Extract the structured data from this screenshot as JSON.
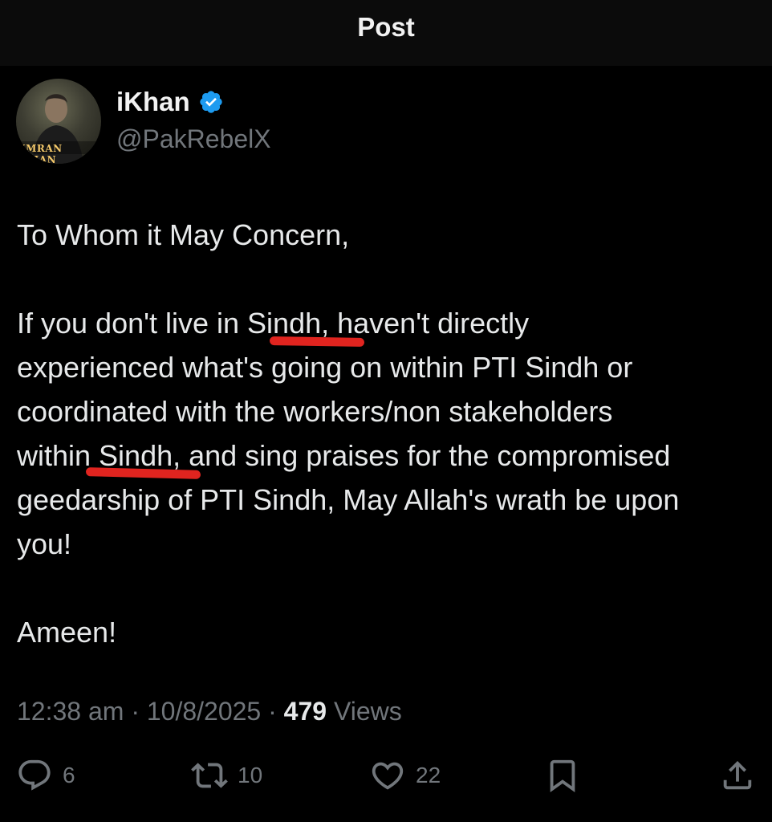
{
  "header": {
    "title": "Post"
  },
  "author": {
    "display_name": "iKhan",
    "handle": "@PakRebelX",
    "verified": true,
    "avatar_caption": "IMRAN KHAN"
  },
  "post": {
    "greeting": "To Whom it May Concern,",
    "paragraph": [
      "If you don't live in Sindh, haven't directly",
      "experienced what's going on within PTI Sindh or",
      "coordinated with the workers/non stakeholders",
      "within Sindh, and sing praises for the compromised",
      "geedarship of PTI Sindh, May Allah's wrath be upon",
      "you!"
    ],
    "closing": "Ameen!"
  },
  "meta": {
    "time": "12:38 am",
    "separator": "·",
    "date": "10/8/2025",
    "views_count": "479",
    "views_label": "Views"
  },
  "actions": {
    "replies": "6",
    "reposts": "10",
    "likes": "22"
  },
  "colors": {
    "background": "#000000",
    "text": "#e7e9ea",
    "muted": "#71767b",
    "verified_blue": "#1d9bf0",
    "annotation_red": "#e0241f"
  }
}
